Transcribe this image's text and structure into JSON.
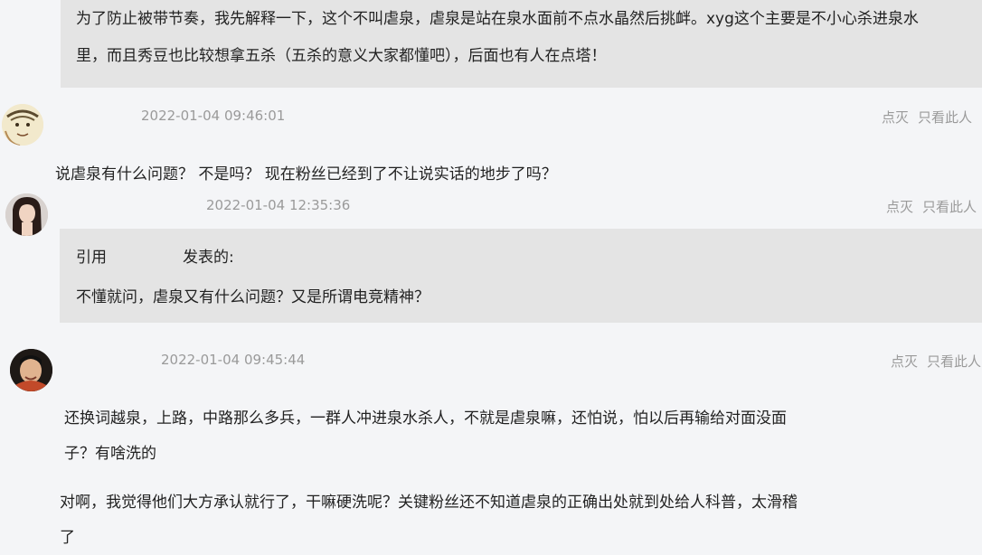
{
  "top_quote": {
    "line1": "为了防止被带节奏，我先解释一下，这个不叫虐泉，虐泉是站在泉水面前不点水晶然后挑衅。xyg这个主要是不小心杀进泉水",
    "line2": "里，而且秀豆也比较想拿五杀（五杀的意义大家都懂吧），后面也有人在点塔！"
  },
  "posts": [
    {
      "time": "2022-01-04 09:46:01",
      "action_1": "点灭",
      "action_2": "只看此人",
      "content": "说虐泉有什么问题？ 不是吗？ 现在粉丝已经到了不让说实话的地步了吗？"
    },
    {
      "time": "2022-01-04 12:35:36",
      "action_1": "点灭",
      "action_2": "只看此人",
      "quote_prefix": "引用",
      "quote_suffix": "发表的:",
      "quote_text": "不懂就问，虐泉又有什么问题？又是所谓电竞精神？"
    },
    {
      "time": "2022-01-04 09:45:44",
      "action_1": "点灭",
      "action_2": "只看此人",
      "content_line1": "还换词越泉，上路，中路那么多兵，一群人冲进泉水杀人，不就是虐泉嘛，还怕说，怕以后再输给对面没面",
      "content_line2": "子？有啥洗的",
      "content2_line1": "对啊，我觉得他们大方承认就行了，干嘛硬洗呢？关键粉丝还不知道虐泉的正确出处就到处给人科普，太滑稽",
      "content2_line2": "了"
    }
  ],
  "icons": [
    "avatar-sketch",
    "avatar-woman",
    "avatar-man"
  ]
}
